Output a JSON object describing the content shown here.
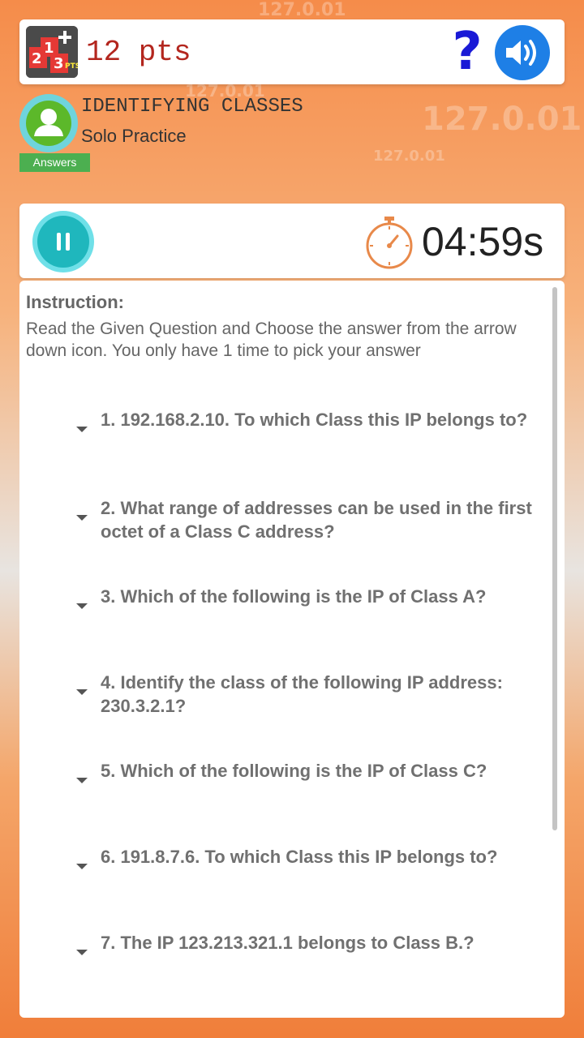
{
  "header": {
    "points_label": "12 pts",
    "logo_numbers": [
      "2",
      "1",
      "3",
      "PTS"
    ],
    "help_symbol": "?",
    "logo_icon": "points-badge-icon",
    "sound_icon": "speaker-icon"
  },
  "profile": {
    "title": "IDENTIFYING CLASSES",
    "subtitle": "Solo Practice",
    "answers_label": "Answers",
    "avatar_icon": "user-icon"
  },
  "timer": {
    "time": "04:59s",
    "pause_icon": "pause-icon",
    "stopwatch_icon": "stopwatch-icon"
  },
  "instruction": {
    "label": "Instruction:",
    "text": "Read the Given Question and Choose the answer from the arrow down icon. You only have 1 time to pick your answer"
  },
  "questions": [
    "1. 192.168.2.10. To which Class this IP belongs to?",
    "2. What range of addresses can be used in the first octet of a Class C address?",
    "3. Which of the following is the IP of Class A?",
    "4. Identify the class of the following IP address: 230.3.2.1?",
    "5. Which of the following is the IP of Class C?",
    "6. 191.8.7.6. To which Class this IP belongs to?",
    "7. The IP 123.213.321.1 belongs to Class B.?"
  ],
  "background_text": [
    "127.0.01",
    "127.0.01",
    "127.0.01",
    "127.0.01"
  ],
  "colors": {
    "accent_blue": "#1e7fe6",
    "points_red": "#b3261e",
    "pause_teal": "#1fb7bd",
    "answers_green": "#4caf50",
    "stopwatch_orange": "#e8894a"
  }
}
